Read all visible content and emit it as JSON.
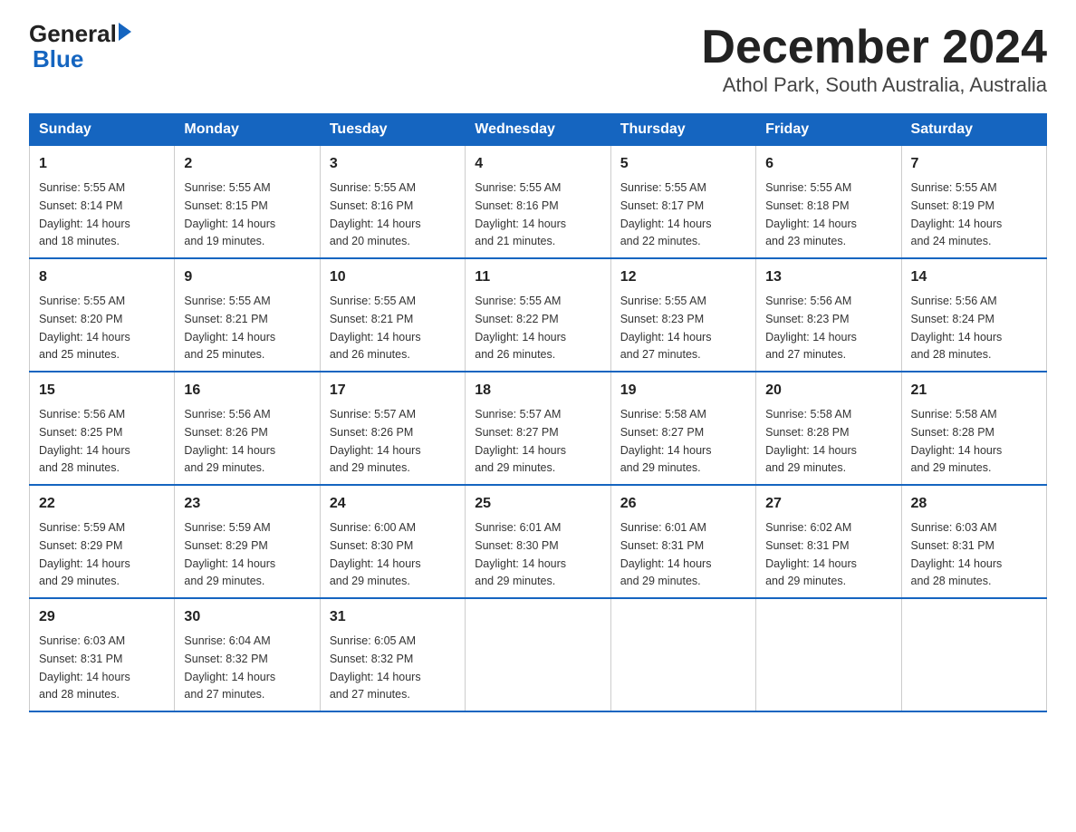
{
  "logo": {
    "general": "General",
    "blue": "Blue"
  },
  "title": "December 2024",
  "subtitle": "Athol Park, South Australia, Australia",
  "weekdays": [
    "Sunday",
    "Monday",
    "Tuesday",
    "Wednesday",
    "Thursday",
    "Friday",
    "Saturday"
  ],
  "weeks": [
    [
      {
        "day": "1",
        "sunrise": "5:55 AM",
        "sunset": "8:14 PM",
        "daylight": "14 hours and 18 minutes."
      },
      {
        "day": "2",
        "sunrise": "5:55 AM",
        "sunset": "8:15 PM",
        "daylight": "14 hours and 19 minutes."
      },
      {
        "day": "3",
        "sunrise": "5:55 AM",
        "sunset": "8:16 PM",
        "daylight": "14 hours and 20 minutes."
      },
      {
        "day": "4",
        "sunrise": "5:55 AM",
        "sunset": "8:16 PM",
        "daylight": "14 hours and 21 minutes."
      },
      {
        "day": "5",
        "sunrise": "5:55 AM",
        "sunset": "8:17 PM",
        "daylight": "14 hours and 22 minutes."
      },
      {
        "day": "6",
        "sunrise": "5:55 AM",
        "sunset": "8:18 PM",
        "daylight": "14 hours and 23 minutes."
      },
      {
        "day": "7",
        "sunrise": "5:55 AM",
        "sunset": "8:19 PM",
        "daylight": "14 hours and 24 minutes."
      }
    ],
    [
      {
        "day": "8",
        "sunrise": "5:55 AM",
        "sunset": "8:20 PM",
        "daylight": "14 hours and 25 minutes."
      },
      {
        "day": "9",
        "sunrise": "5:55 AM",
        "sunset": "8:21 PM",
        "daylight": "14 hours and 25 minutes."
      },
      {
        "day": "10",
        "sunrise": "5:55 AM",
        "sunset": "8:21 PM",
        "daylight": "14 hours and 26 minutes."
      },
      {
        "day": "11",
        "sunrise": "5:55 AM",
        "sunset": "8:22 PM",
        "daylight": "14 hours and 26 minutes."
      },
      {
        "day": "12",
        "sunrise": "5:55 AM",
        "sunset": "8:23 PM",
        "daylight": "14 hours and 27 minutes."
      },
      {
        "day": "13",
        "sunrise": "5:56 AM",
        "sunset": "8:23 PM",
        "daylight": "14 hours and 27 minutes."
      },
      {
        "day": "14",
        "sunrise": "5:56 AM",
        "sunset": "8:24 PM",
        "daylight": "14 hours and 28 minutes."
      }
    ],
    [
      {
        "day": "15",
        "sunrise": "5:56 AM",
        "sunset": "8:25 PM",
        "daylight": "14 hours and 28 minutes."
      },
      {
        "day": "16",
        "sunrise": "5:56 AM",
        "sunset": "8:26 PM",
        "daylight": "14 hours and 29 minutes."
      },
      {
        "day": "17",
        "sunrise": "5:57 AM",
        "sunset": "8:26 PM",
        "daylight": "14 hours and 29 minutes."
      },
      {
        "day": "18",
        "sunrise": "5:57 AM",
        "sunset": "8:27 PM",
        "daylight": "14 hours and 29 minutes."
      },
      {
        "day": "19",
        "sunrise": "5:58 AM",
        "sunset": "8:27 PM",
        "daylight": "14 hours and 29 minutes."
      },
      {
        "day": "20",
        "sunrise": "5:58 AM",
        "sunset": "8:28 PM",
        "daylight": "14 hours and 29 minutes."
      },
      {
        "day": "21",
        "sunrise": "5:58 AM",
        "sunset": "8:28 PM",
        "daylight": "14 hours and 29 minutes."
      }
    ],
    [
      {
        "day": "22",
        "sunrise": "5:59 AM",
        "sunset": "8:29 PM",
        "daylight": "14 hours and 29 minutes."
      },
      {
        "day": "23",
        "sunrise": "5:59 AM",
        "sunset": "8:29 PM",
        "daylight": "14 hours and 29 minutes."
      },
      {
        "day": "24",
        "sunrise": "6:00 AM",
        "sunset": "8:30 PM",
        "daylight": "14 hours and 29 minutes."
      },
      {
        "day": "25",
        "sunrise": "6:01 AM",
        "sunset": "8:30 PM",
        "daylight": "14 hours and 29 minutes."
      },
      {
        "day": "26",
        "sunrise": "6:01 AM",
        "sunset": "8:31 PM",
        "daylight": "14 hours and 29 minutes."
      },
      {
        "day": "27",
        "sunrise": "6:02 AM",
        "sunset": "8:31 PM",
        "daylight": "14 hours and 29 minutes."
      },
      {
        "day": "28",
        "sunrise": "6:03 AM",
        "sunset": "8:31 PM",
        "daylight": "14 hours and 28 minutes."
      }
    ],
    [
      {
        "day": "29",
        "sunrise": "6:03 AM",
        "sunset": "8:31 PM",
        "daylight": "14 hours and 28 minutes."
      },
      {
        "day": "30",
        "sunrise": "6:04 AM",
        "sunset": "8:32 PM",
        "daylight": "14 hours and 27 minutes."
      },
      {
        "day": "31",
        "sunrise": "6:05 AM",
        "sunset": "8:32 PM",
        "daylight": "14 hours and 27 minutes."
      },
      null,
      null,
      null,
      null
    ]
  ],
  "labels": {
    "sunrise": "Sunrise:",
    "sunset": "Sunset:",
    "daylight": "Daylight:"
  }
}
